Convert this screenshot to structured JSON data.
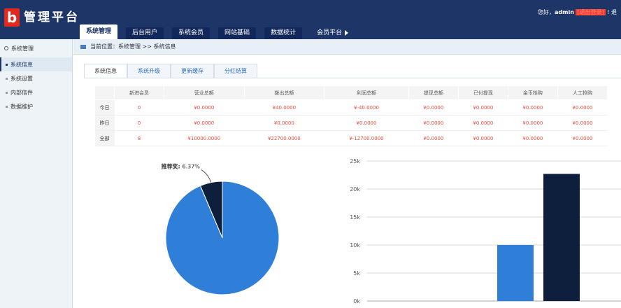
{
  "header": {
    "logo_letter": "b",
    "logo_text": "管理平台",
    "nav_tabs": [
      {
        "label": "系统管理",
        "active": true
      },
      {
        "label": "后台用户",
        "active": false
      },
      {
        "label": "系统会员",
        "active": false
      },
      {
        "label": "网站基础",
        "active": false
      },
      {
        "label": "数据统计",
        "active": false
      },
      {
        "label": "会员平台",
        "active": false
      }
    ],
    "greeting": "您好，",
    "username": "admin",
    "logout": "[退出登录]",
    "extra": "! 退"
  },
  "sidebar": {
    "title": "系统管理",
    "items": [
      {
        "label": "系统信息",
        "active": true
      },
      {
        "label": "系统设置",
        "active": false
      },
      {
        "label": "内部信件",
        "active": false
      },
      {
        "label": "数据维护",
        "active": false
      }
    ]
  },
  "breadcrumb": "当前位置：系统管理 >> 系统信息",
  "tabs": [
    {
      "label": "系统信息",
      "active": true
    },
    {
      "label": "系统升级",
      "active": false
    },
    {
      "label": "更新缓存",
      "active": false
    },
    {
      "label": "分红结算",
      "active": false
    }
  ],
  "table": {
    "headers": [
      "新进会员",
      "营业总额",
      "拨出总额",
      "利润总额",
      "提现总额",
      "已付提现",
      "金币抢购",
      "人工抢购"
    ],
    "rows": [
      {
        "label": "今日",
        "cells": [
          "0",
          "¥0.0000",
          "¥40.0000",
          "¥-40.0000",
          "¥0.0000",
          "¥0.0000",
          "¥0.0000",
          "¥0.0000"
        ]
      },
      {
        "label": "昨日",
        "cells": [
          "0",
          "¥0.0000",
          "¥0.0000",
          "¥0.0000",
          "¥0.0000",
          "¥0.0000",
          "¥0.0000",
          "¥0.0000"
        ]
      },
      {
        "label": "全部",
        "cells": [
          "8",
          "¥10000.0000",
          "¥22700.0000",
          "¥-12700.0000",
          "¥0.0000",
          "¥0.0000",
          "¥0.0000",
          "¥0.0000"
        ]
      }
    ]
  },
  "chart_data": [
    {
      "type": "pie",
      "slices": [
        {
          "label": "推荐奖",
          "percent": 6.37,
          "color": "#0d1f3c"
        },
        {
          "label": "",
          "percent": 93.63,
          "color": "#2f7ed8"
        }
      ],
      "visible_label": "推荐奖",
      "visible_percent": "6.37%"
    },
    {
      "type": "bar",
      "values": [
        10000,
        22700
      ],
      "colors": [
        "#2f7ed8",
        "#0d1f3c"
      ],
      "ylim": [
        0,
        25000
      ],
      "yticks": [
        "0k",
        "5k",
        "10k",
        "15k",
        "20k",
        "25k"
      ],
      "grid": true
    }
  ]
}
